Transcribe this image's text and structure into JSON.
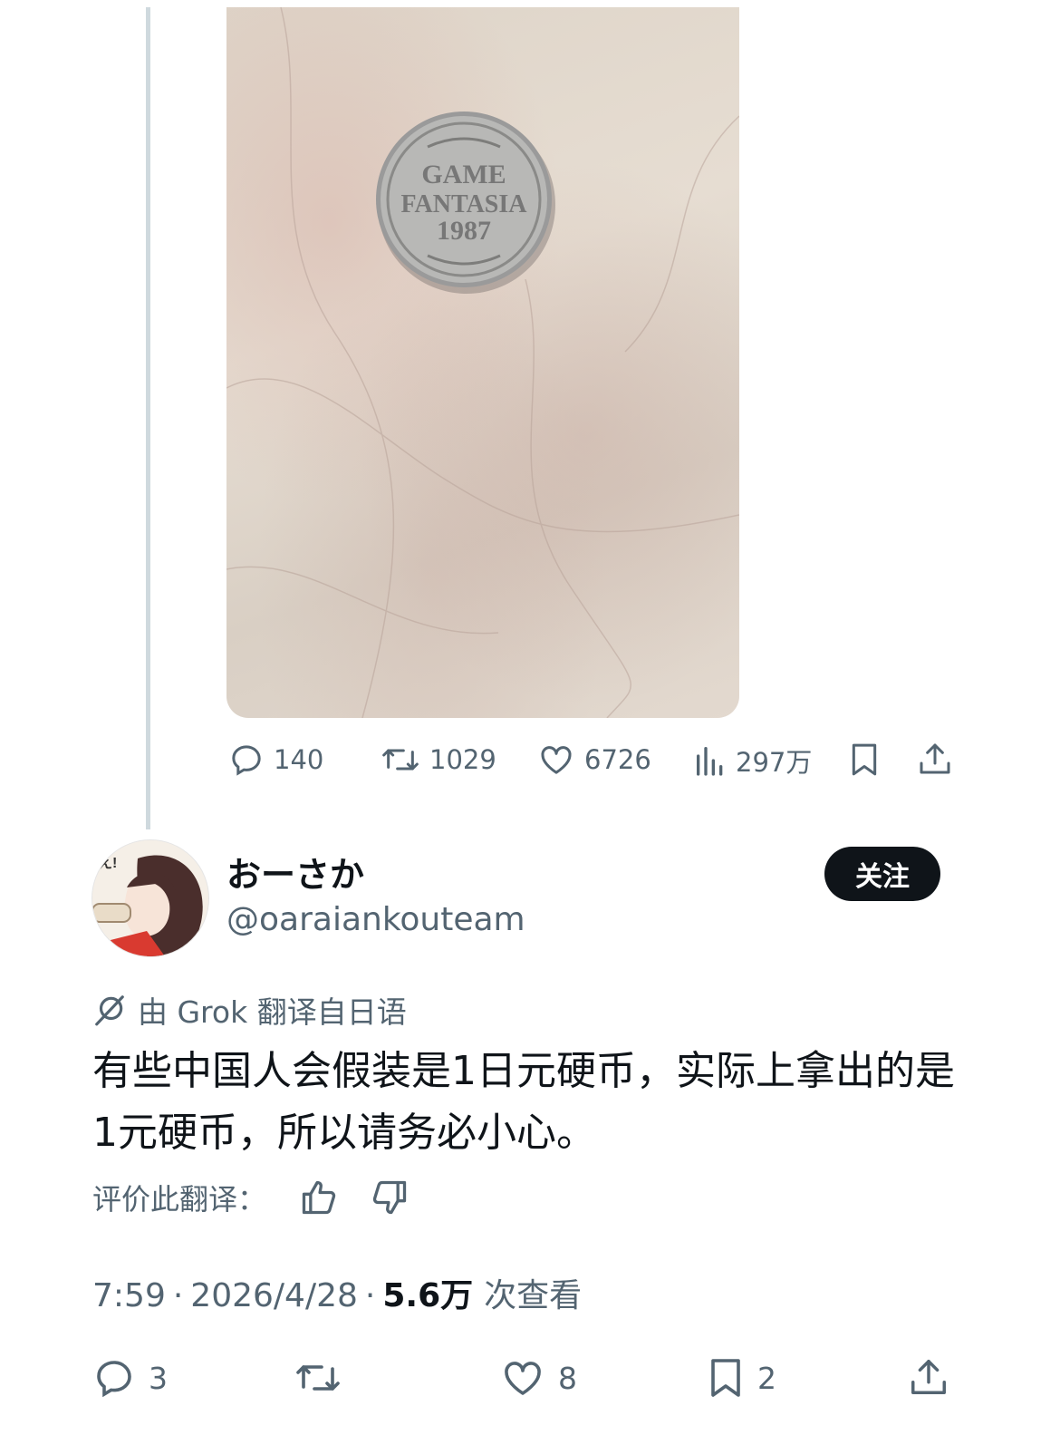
{
  "parent_tweet": {
    "image_alt": "GAME FANTASIA 1987 token coin on marble surface",
    "coin_text": [
      "GAME",
      "FANTASIA",
      "1987"
    ],
    "actions": {
      "reply_count": "140",
      "retweet_count": "1029",
      "like_count": "6726",
      "view_count": "297万"
    }
  },
  "tweet": {
    "display_name": "おーさか",
    "handle": "@oaraiankouteam",
    "follow_label": "关注",
    "translated_by": "由 Grok 翻译自日语",
    "text": "有些中国人会假装是1日元硬币，实际上拿出的是1元硬币，所以请务必小心。",
    "rate_label": "评价此翻译：",
    "time": "7:59",
    "date": "2026/4/28",
    "separator": "·",
    "views_value": "5.6万",
    "views_label": "次查看",
    "actions": {
      "reply_count": "3",
      "like_count": "8",
      "bookmark_count": "2"
    }
  },
  "colors": {
    "text_primary": "#0f1419",
    "text_secondary": "#536471",
    "thread_line": "#cfd9de",
    "follow_bg": "#0f1419"
  },
  "icons": [
    "reply-icon",
    "retweet-icon",
    "like-icon",
    "views-icon",
    "bookmark-icon",
    "share-icon",
    "grok-icon",
    "thumbs-up-icon",
    "thumbs-down-icon"
  ]
}
